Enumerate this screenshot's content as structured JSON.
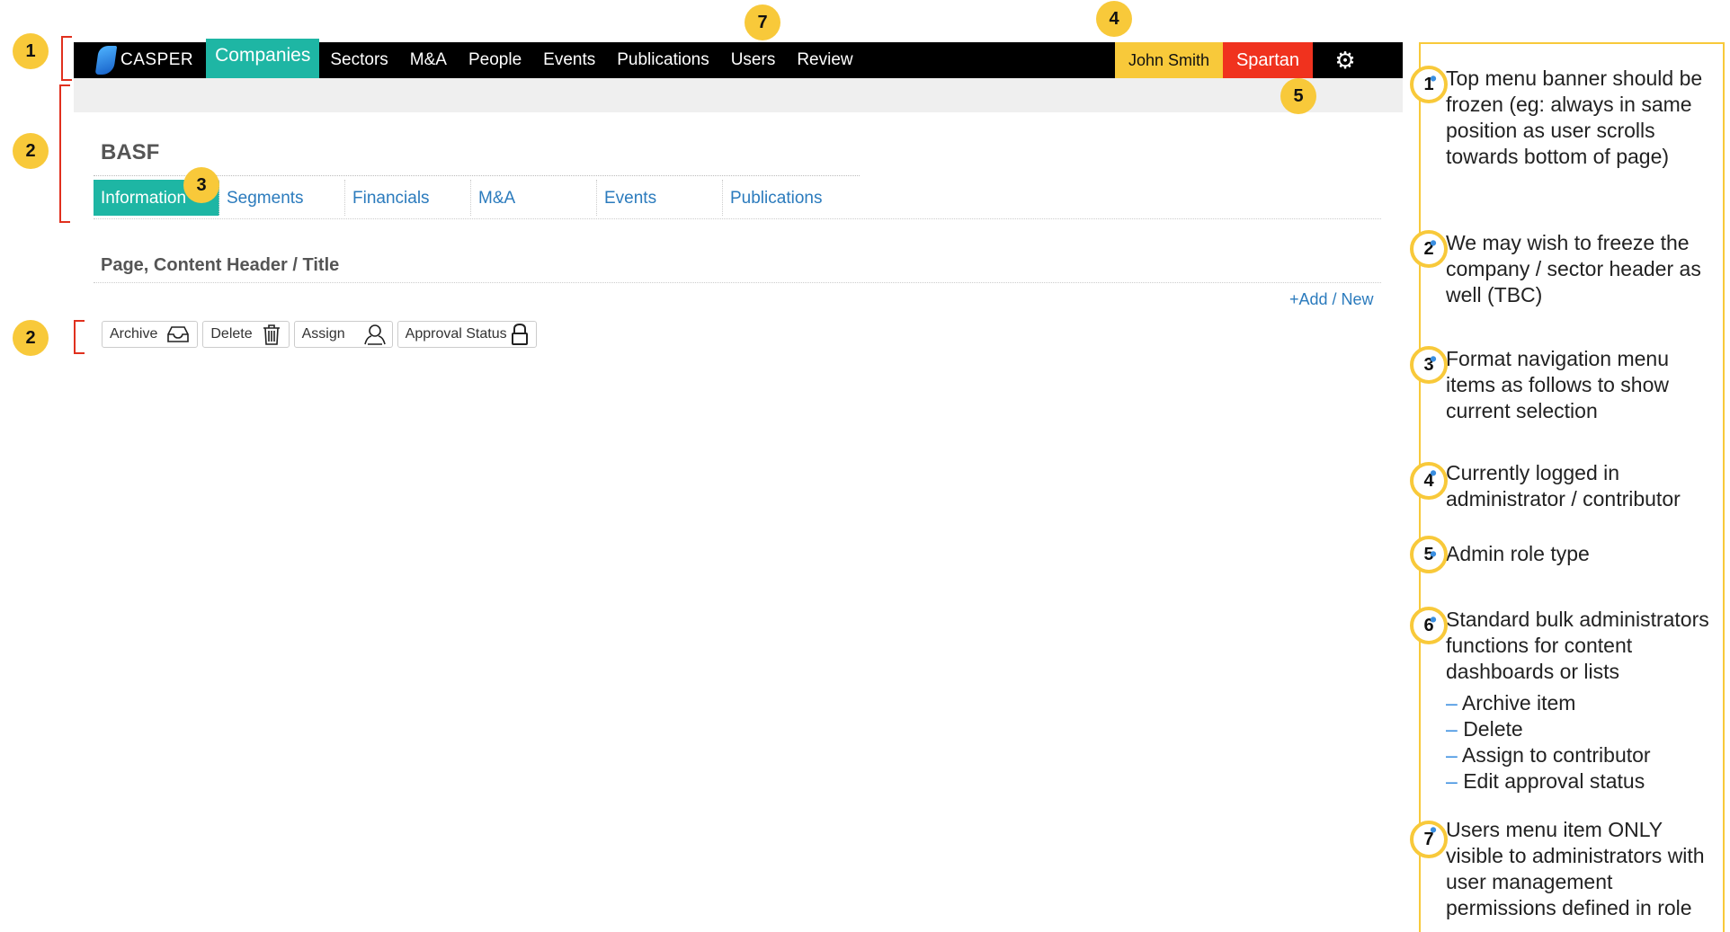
{
  "topbar": {
    "logo_text": "CASPER",
    "nav": [
      "Companies",
      "Sectors",
      "M&A",
      "People",
      "Events",
      "Publications",
      "Users",
      "Review"
    ],
    "active_nav": "Companies",
    "user_name": "John Smith",
    "role": "Spartan"
  },
  "company": {
    "title": "BASF",
    "tabs": [
      "Information",
      "Segments",
      "Financials",
      "M&A",
      "Events",
      "Publications"
    ],
    "active_tab": "Information"
  },
  "content": {
    "page_header": "Page, Content Header / Title",
    "add_link": "+Add / New"
  },
  "bulk_actions": {
    "archive": "Archive",
    "delete": "Delete",
    "assign": "Assign",
    "approval": "Approval Status"
  },
  "callouts": {
    "c1": "1",
    "c2": "2",
    "c3": "3",
    "c4": "4",
    "c5": "5",
    "c6": "6",
    "c7": "7"
  },
  "notes": {
    "n1": "Top menu banner should be frozen (eg: always in same position as user scrolls towards bottom of page)",
    "n2": "We may wish to freeze the company / sector header as well (TBC)",
    "n3": "Format navigation menu items as follows to show current selection",
    "n4": "Currently logged in administrator / contributor",
    "n5": "Admin role type",
    "n6": "Standard bulk administrators functions for content dashboards or lists",
    "n6_items": [
      "Archive item",
      "Delete",
      "Assign to contributor",
      "Edit approval status"
    ],
    "n7": "Users menu item ONLY visible to administrators with user management permissions defined in role"
  },
  "colors": {
    "accent": "#1eb6a4",
    "callout": "#f8c93a",
    "role": "#f0321e",
    "link": "#2b7bbd"
  },
  "icons": [
    "casper-logo-icon",
    "gear-icon",
    "inbox-icon",
    "trash-icon",
    "user-icon",
    "lock-icon"
  ]
}
